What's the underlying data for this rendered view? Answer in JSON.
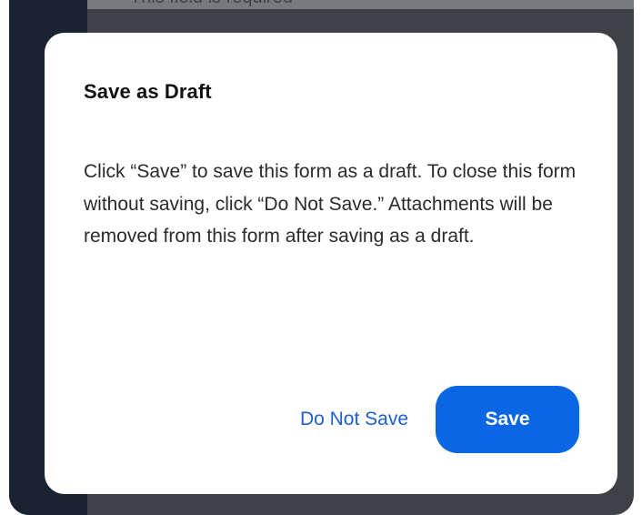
{
  "background": {
    "helper_text": "This field is required"
  },
  "dialog": {
    "title": "Save as Draft",
    "message": "Click “Save” to save this form as a draft. To close this form without saving, click “Do Not Save.” Attachments will be removed from this form after saving as a draft.",
    "secondary_action_label": "Do Not Save",
    "primary_action_label": "Save"
  },
  "colors": {
    "primary_button": "#0b66e4",
    "link": "#1d5fd3",
    "overlay": "#3f4146",
    "sidebar": "#1a2332"
  }
}
